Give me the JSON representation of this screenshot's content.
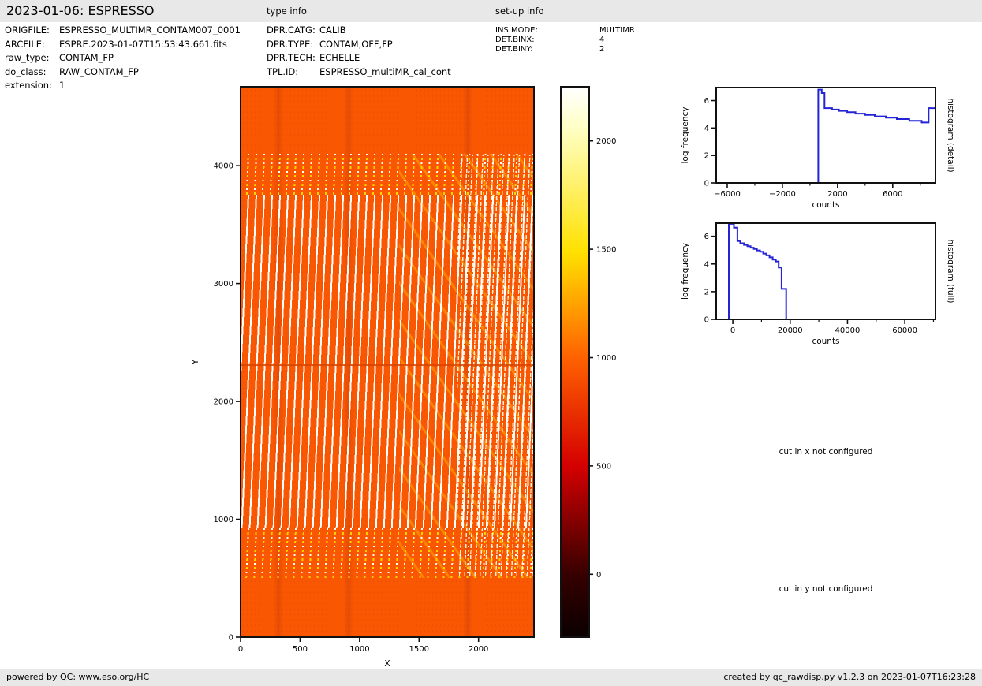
{
  "header": {
    "title": "2023-01-06: ESPRESSO",
    "type_info_heading": "type info",
    "setup_info_heading": "set-up info"
  },
  "metadata": {
    "rows": [
      {
        "label": "ORIGFILE:",
        "value": "ESPRESSO_MULTIMR_CONTAM007_0001"
      },
      {
        "label": "ARCFILE:",
        "value": "ESPRE.2023-01-07T15:53:43.661.fits"
      },
      {
        "label": "raw_type:",
        "value": "CONTAM_FP"
      },
      {
        "label": "do_class:",
        "value": "RAW_CONTAM_FP"
      },
      {
        "label": "extension:",
        "value": "1"
      }
    ]
  },
  "type_info": {
    "rows": [
      {
        "label": "DPR.CATG:",
        "value": "CALIB"
      },
      {
        "label": "DPR.TYPE:",
        "value": "CONTAM,OFF,FP"
      },
      {
        "label": "DPR.TECH:",
        "value": "ECHELLE"
      },
      {
        "label": "TPL.ID:",
        "value": "ESPRESSO_multiMR_cal_cont"
      }
    ]
  },
  "setup_info": {
    "rows": [
      {
        "label": "INS.MODE:",
        "value": "MULTIMR"
      },
      {
        "label": "DET.BINX:",
        "value": "4"
      },
      {
        "label": "DET.BINY:",
        "value": "2"
      }
    ]
  },
  "notes": {
    "cut_x": "cut in x not configured",
    "cut_y": "cut in y not configured"
  },
  "footer": {
    "left": "powered by QC: www.eso.org/HC",
    "right": "created by qc_rawdisp.py v1.2.3 on 2023-01-07T16:23:28"
  },
  "colors": {
    "band-gray": "#e8e8e8",
    "image-base": "#fa5703",
    "stripe-white": "#ffffff",
    "speckle-gold": "#ffd300",
    "dark-line": "#d84400",
    "hist-blue": "#2424d6",
    "axis-black": "#111111"
  },
  "chart_data": [
    {
      "id": "raw-image",
      "type": "heatmap",
      "title": "",
      "xlabel": "X",
      "ylabel": "Y",
      "xlim": [
        0,
        2466
      ],
      "ylim": [
        0,
        4670
      ],
      "xticks": [
        0,
        500,
        1000,
        1500,
        2000
      ],
      "yticks": [
        0,
        1000,
        2000,
        3000,
        4000
      ],
      "colormap": "hot",
      "background_level_counts": 1000,
      "description": "Raw ESPRESSO Fabry-Perot contamination frame: uniform orange background near 1000 counts with ~40 slightly slanted bright echelle-order stripes spanning y=500 to y=4100, yellow dashed stripe tips at top and bottom, a dark horizontal detector row at y=2320, denser dashed orders and diagonal bright chains toward the right edge"
    },
    {
      "id": "colorbar",
      "type": "colorbar",
      "range": [
        -290,
        2250
      ],
      "ticks": [
        0,
        500,
        1000,
        1500,
        2000
      ],
      "stops": [
        [
          0,
          "#0b0000"
        ],
        [
          11,
          "#350000"
        ],
        [
          31,
          "#d40000"
        ],
        [
          51,
          "#ff6300"
        ],
        [
          70,
          "#ffe100"
        ],
        [
          93,
          "#ffffc8"
        ],
        [
          100,
          "#ffffff"
        ]
      ]
    },
    {
      "id": "hist-detail",
      "type": "line",
      "right_label": "histogram (detail)",
      "xlabel": "counts",
      "ylabel": "log frequency",
      "xlim": [
        -6800,
        9100
      ],
      "ylim": [
        0,
        6.95
      ],
      "xticks": [
        -6000,
        -2000,
        2000,
        6000
      ],
      "xticks_minor": [
        -4000,
        0,
        4000,
        8000
      ],
      "yticks": [
        0,
        2,
        4,
        6
      ],
      "grid": false,
      "steps": [
        [
          -6800,
          0
        ],
        [
          600,
          0
        ],
        [
          600,
          6.8
        ],
        [
          850,
          6.8
        ],
        [
          850,
          6.55
        ],
        [
          1050,
          6.55
        ],
        [
          1050,
          5.45
        ],
        [
          1600,
          5.45
        ],
        [
          1600,
          5.35
        ],
        [
          2100,
          5.35
        ],
        [
          2100,
          5.25
        ],
        [
          2700,
          5.25
        ],
        [
          2700,
          5.15
        ],
        [
          3300,
          5.15
        ],
        [
          3300,
          5.05
        ],
        [
          4000,
          5.05
        ],
        [
          4000,
          4.95
        ],
        [
          4700,
          4.95
        ],
        [
          4700,
          4.85
        ],
        [
          5500,
          4.85
        ],
        [
          5500,
          4.75
        ],
        [
          6300,
          4.75
        ],
        [
          6300,
          4.65
        ],
        [
          7200,
          4.65
        ],
        [
          7200,
          4.52
        ],
        [
          8100,
          4.52
        ],
        [
          8100,
          4.4
        ],
        [
          8600,
          4.4
        ],
        [
          8600,
          5.45
        ],
        [
          9100,
          5.45
        ]
      ]
    },
    {
      "id": "hist-full",
      "type": "line",
      "right_label": "histogram (full)",
      "xlabel": "counts",
      "ylabel": "log frequency",
      "xlim": [
        -5800,
        70700
      ],
      "ylim": [
        0,
        6.95
      ],
      "xticks": [
        0,
        20000,
        40000,
        60000
      ],
      "xticks_minor": [
        10000,
        30000,
        50000,
        70000
      ],
      "yticks": [
        0,
        2,
        4,
        6
      ],
      "grid": false,
      "steps": [
        [
          -5800,
          0
        ],
        [
          -1400,
          0
        ],
        [
          -1400,
          6.9
        ],
        [
          400,
          6.9
        ],
        [
          400,
          6.62
        ],
        [
          1600,
          6.62
        ],
        [
          1600,
          5.65
        ],
        [
          2600,
          5.65
        ],
        [
          2600,
          5.5
        ],
        [
          3900,
          5.5
        ],
        [
          3900,
          5.38
        ],
        [
          5100,
          5.38
        ],
        [
          5100,
          5.28
        ],
        [
          6200,
          5.28
        ],
        [
          6200,
          5.18
        ],
        [
          7300,
          5.18
        ],
        [
          7300,
          5.08
        ],
        [
          8400,
          5.08
        ],
        [
          8400,
          4.98
        ],
        [
          9500,
          4.98
        ],
        [
          9500,
          4.88
        ],
        [
          10600,
          4.88
        ],
        [
          10600,
          4.75
        ],
        [
          11700,
          4.75
        ],
        [
          11700,
          4.62
        ],
        [
          12800,
          4.62
        ],
        [
          12800,
          4.48
        ],
        [
          13900,
          4.48
        ],
        [
          13900,
          4.32
        ],
        [
          15000,
          4.32
        ],
        [
          15000,
          4.18
        ],
        [
          16000,
          4.18
        ],
        [
          16000,
          3.75
        ],
        [
          17000,
          3.75
        ],
        [
          17000,
          2.2
        ],
        [
          18600,
          2.2
        ],
        [
          18600,
          0
        ],
        [
          70700,
          0
        ]
      ]
    }
  ]
}
